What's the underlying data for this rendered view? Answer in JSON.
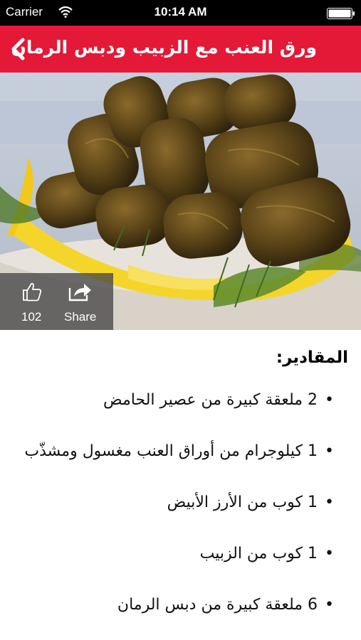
{
  "status_bar": {
    "carrier": "Carrier",
    "time": "10:14 AM"
  },
  "nav": {
    "title": "ورق العنب مع الزبيب ودبس الرمان",
    "back_icon": "chevron-left-icon"
  },
  "social": {
    "like_count": "102",
    "share_label": "Share",
    "like_icon": "thumbs-up-icon",
    "share_icon": "share-icon"
  },
  "recipe": {
    "ingredients_heading": "المقادير:",
    "ingredients": [
      "2 ملعقة كبيرة من عصير الحامض",
      "1 كيلوجرام من أوراق العنب مغسول ومشذّب",
      "1 كوب من الأرز الأبيض",
      "1 كوب من الزبيب",
      "6 ملعقة كبيرة من دبس الرمان"
    ]
  },
  "colors": {
    "accent": "#e31937"
  }
}
